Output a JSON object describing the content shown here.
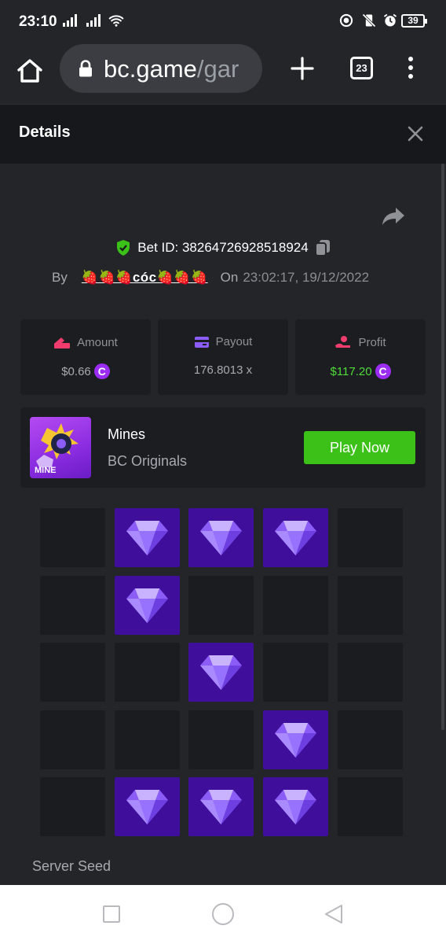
{
  "status_bar": {
    "time": "23:10",
    "battery": "39"
  },
  "browser": {
    "url_main": "bc.game",
    "url_rest": "/gar",
    "tab_count": "23"
  },
  "details": {
    "title": "Details"
  },
  "bet": {
    "id_label": "Bet ID: 38264726928518924",
    "by_label": "By",
    "user": "🍓🍓🍓cóc🍓🍓🍓",
    "on_label": "On",
    "timestamp": "23:02:17, 19/12/2022"
  },
  "stats": {
    "amount": {
      "label": "Amount",
      "value": "$0.66"
    },
    "payout": {
      "label": "Payout",
      "value": "176.8013 x"
    },
    "profit": {
      "label": "Profit",
      "value": "$117.20"
    },
    "coin_symbol": "C"
  },
  "game": {
    "name": "Mines",
    "provider": "BC Originals",
    "thumb_text": "MINE",
    "play_label": "Play Now"
  },
  "board": {
    "rows": 5,
    "cols": 5,
    "cells": [
      [
        0,
        1,
        1,
        1,
        0
      ],
      [
        0,
        1,
        0,
        0,
        0
      ],
      [
        0,
        0,
        1,
        0,
        0
      ],
      [
        0,
        0,
        0,
        1,
        0
      ],
      [
        0,
        1,
        1,
        1,
        0
      ]
    ],
    "gem_color": "#8b5cf6",
    "tile_color": "#3f0e9a"
  },
  "seed": {
    "label": "Server Seed"
  },
  "colors": {
    "green": "#3bc117",
    "accent_purple": "#9b2cf2",
    "background": "#232529"
  }
}
